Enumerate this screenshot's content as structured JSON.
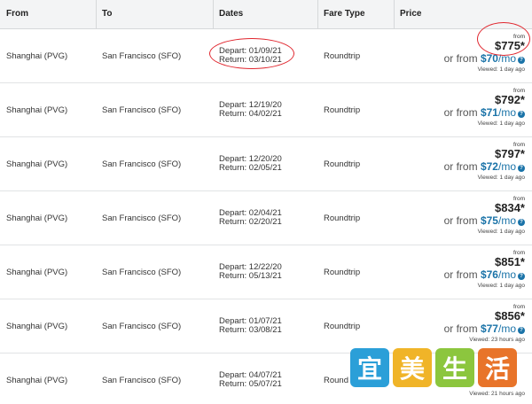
{
  "header": {
    "from": "From",
    "to": "To",
    "dates": "Dates",
    "fare_type": "Fare Type",
    "price": "Price"
  },
  "rows": [
    {
      "from": "Shanghai (PVG)",
      "to": "San Francisco (SFO)",
      "depart": "Depart: 01/09/21",
      "return": "Return: 03/10/21",
      "fare": "Roundtrip",
      "from_label": "from",
      "price": "$775*",
      "or_from": "or from",
      "monthly": "$70",
      "mo": "/mo",
      "viewed": "Viewed: 1 day ago"
    },
    {
      "from": "Shanghai (PVG)",
      "to": "San Francisco (SFO)",
      "depart": "Depart: 12/19/20",
      "return": "Return: 04/02/21",
      "fare": "Roundtrip",
      "from_label": "from",
      "price": "$792*",
      "or_from": "or from",
      "monthly": "$71",
      "mo": "/mo",
      "viewed": "Viewed: 1 day ago"
    },
    {
      "from": "Shanghai (PVG)",
      "to": "San Francisco (SFO)",
      "depart": "Depart: 12/20/20",
      "return": "Return: 02/05/21",
      "fare": "Roundtrip",
      "from_label": "from",
      "price": "$797*",
      "or_from": "or from",
      "monthly": "$72",
      "mo": "/mo",
      "viewed": "Viewed: 1 day ago"
    },
    {
      "from": "Shanghai (PVG)",
      "to": "San Francisco (SFO)",
      "depart": "Depart: 02/04/21",
      "return": "Return: 02/20/21",
      "fare": "Roundtrip",
      "from_label": "from",
      "price": "$834*",
      "or_from": "or from",
      "monthly": "$75",
      "mo": "/mo",
      "viewed": "Viewed: 1 day ago"
    },
    {
      "from": "Shanghai (PVG)",
      "to": "San Francisco (SFO)",
      "depart": "Depart: 12/22/20",
      "return": "Return: 05/13/21",
      "fare": "Roundtrip",
      "from_label": "from",
      "price": "$851*",
      "or_from": "or from",
      "monthly": "$76",
      "mo": "/mo",
      "viewed": "Viewed: 1 day ago"
    },
    {
      "from": "Shanghai (PVG)",
      "to": "San Francisco (SFO)",
      "depart": "Depart: 01/07/21",
      "return": "Return: 03/08/21",
      "fare": "Roundtrip",
      "from_label": "from",
      "price": "$856*",
      "or_from": "or from",
      "monthly": "$77",
      "mo": "/mo",
      "viewed": "Viewed: 23 hours ago"
    },
    {
      "from": "Shanghai (PVG)",
      "to": "San Francisco (SFO)",
      "depart": "Depart: 04/07/21",
      "return": "Return: 05/07/21",
      "fare": "Round",
      "from_label": "",
      "price": "",
      "or_from": "",
      "monthly": "",
      "mo": "",
      "viewed": "Viewed: 21 hours ago"
    }
  ],
  "info_icon": "?",
  "watermark": {
    "chars": [
      "宜",
      "美",
      "生",
      "活"
    ],
    "colors": [
      "#2b9fd8",
      "#f0b428",
      "#8cc63e",
      "#e8742a"
    ]
  },
  "colors": {
    "accent": "#1a73a8",
    "annotation": "#e0262e"
  }
}
